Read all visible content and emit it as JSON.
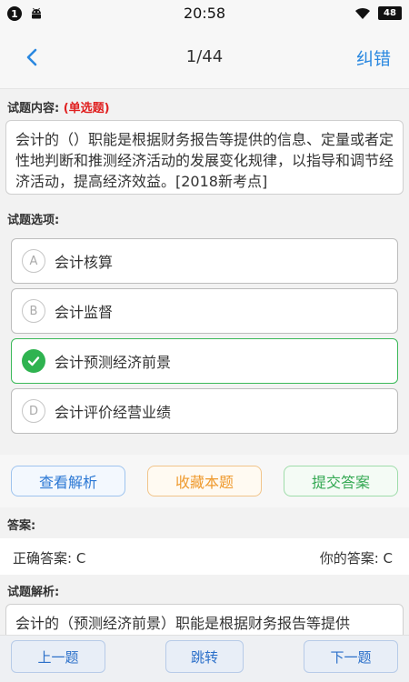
{
  "statusbar": {
    "notification_count": "1",
    "time": "20:58",
    "battery": "48"
  },
  "navbar": {
    "title": "1/44",
    "action_label": "纠错"
  },
  "question": {
    "label": "试题内容:",
    "type": "(单选题)",
    "text": "会计的（）职能是根据财务报告等提供的信息、定量或者定性地判断和推测经济活动的发展变化规律，以指导和调节经济活动，提高经济效益。[2018新考点]"
  },
  "options": {
    "label": "试题选项:",
    "items": [
      {
        "letter": "A",
        "text": "会计核算"
      },
      {
        "letter": "B",
        "text": "会计监督"
      },
      {
        "letter": "C",
        "text": "会计预测经济前景"
      },
      {
        "letter": "D",
        "text": "会计评价经营业绩"
      }
    ],
    "selected": "C"
  },
  "actions": {
    "view_analysis": "查看解析",
    "favorite": "收藏本题",
    "submit": "提交答案"
  },
  "answer": {
    "label": "答案:",
    "correct": "正确答案: C",
    "yours": "你的答案: C"
  },
  "analysis": {
    "label": "试题解析:",
    "text": "会计的（预测经济前景）职能是根据财务报告等提供"
  },
  "bottom": {
    "prev": "上一题",
    "jump": "跳转",
    "next": "下一题"
  },
  "colors": {
    "accent_blue": "#2a88e0",
    "correct_green": "#2fb350",
    "type_red": "#e02020",
    "favorite_orange": "#ef9a2e"
  }
}
